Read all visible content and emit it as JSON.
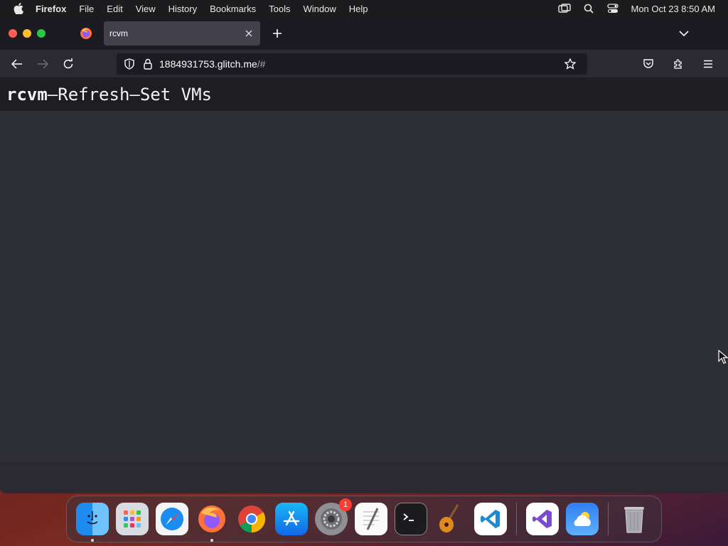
{
  "menubar": {
    "app_name": "Firefox",
    "items": [
      "File",
      "Edit",
      "View",
      "History",
      "Bookmarks",
      "Tools",
      "Window",
      "Help"
    ],
    "clock": "Mon Oct 23  8:50 AM",
    "right_icons": [
      "screen-mirroring-icon",
      "spotlight-search-icon",
      "control-center-icon"
    ]
  },
  "browser": {
    "tab_title": "rcvm",
    "url_host": "1884931753.glitch.me",
    "url_path": "/#"
  },
  "page": {
    "brand": "rcvm",
    "separator": "–",
    "link_refresh": "Refresh",
    "link_set_vms": "Set VMs"
  },
  "dock": {
    "apps": [
      "Finder",
      "Launchpad",
      "Safari",
      "Firefox",
      "Chrome",
      "App Store",
      "System Settings",
      "TextEdit",
      "Terminal",
      "GarageBand",
      "Visual Studio Code",
      "Visual Studio",
      "Weather",
      "Trash"
    ],
    "settings_badge": "1"
  },
  "colors": {
    "page_bg": "#2e2f35",
    "header_bg": "#1e1e22",
    "toolbar_bg": "#2b2a33"
  }
}
